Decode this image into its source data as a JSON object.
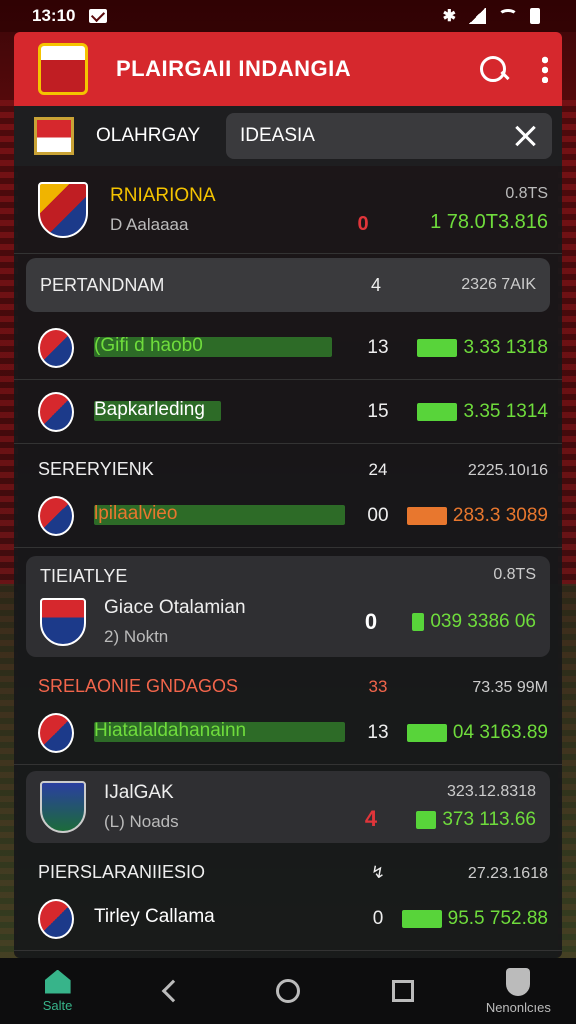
{
  "status": {
    "time": "13:10"
  },
  "appbar": {
    "title": "PLAIRGAII INDANGIA"
  },
  "filter": {
    "label": "OLAHRGAY",
    "search_value": "IDEASIA"
  },
  "featured": {
    "team_title": "RNIARIONA",
    "team_sub": "D Aalaaaa",
    "score": "0",
    "odds_top": "0.8TS",
    "odds_main": "1 78.0T3.816"
  },
  "section1": {
    "title": "PERTANDNAM",
    "mid": "4",
    "right": "2326 7AIK"
  },
  "rows1": [
    {
      "name": "(Gifi d haob0",
      "num": "13",
      "odds": "3.33 1318",
      "name_color": "#6fdc3c",
      "bar_color": "#2d6b27",
      "bar_pct": 0.9,
      "odds_color": "#6fdc3c",
      "oddbar_color": "#58d43a"
    },
    {
      "name": "Bapkarleding",
      "num": "15",
      "odds": "3.35 1314",
      "name_color": "#ffffff",
      "bar_color": "#2d6b27",
      "bar_pct": 0.48,
      "odds_color": "#6fdc3c",
      "oddbar_color": "#58d43a"
    }
  ],
  "section2": {
    "title": "SERERYIENK",
    "mid": "24",
    "right": "2225.10ı16"
  },
  "rows2": [
    {
      "name": "lpilaalvieo",
      "num": "00",
      "odds": "283.3 3089",
      "name_color": "#e8772e",
      "bar_color": "#2d6b27",
      "bar_pct": 0.95,
      "odds_color": "#e8772e",
      "oddbar_color": "#e8772e"
    }
  ],
  "card1": {
    "title": "TIEIATLYE",
    "right": "0.8TS",
    "team": "Giace Otalamian",
    "sub": "2) Noktn",
    "score": "0",
    "odds": "039 3386 06"
  },
  "section3": {
    "title": "SRELAONIE GNDAGOS",
    "mid": "33",
    "right": "73.35 99M"
  },
  "rows3": [
    {
      "name": "Hiatalaldahanainn",
      "num": "13",
      "odds": "04 3163.89",
      "name_color": "#6fdc3c",
      "bar_color": "#2d6b27",
      "bar_pct": 0.95,
      "odds_color": "#6fdc3c",
      "oddbar_color": "#58d43a"
    }
  ],
  "card2": {
    "team": "IJalGAK",
    "sub": "(L) Noads",
    "score": "4",
    "odds_top": "323.12.8318",
    "odds": "373 113.66"
  },
  "section4": {
    "title": "PIERSLARANIIESIO",
    "mid": "↯",
    "right": "27.23.1618"
  },
  "rows4": [
    {
      "name": "Tirley Callama",
      "num": "0",
      "odds": "95.5 752.88",
      "name_color": "#ffffff",
      "bar_color": "transparent",
      "bar_pct": 0,
      "odds_color": "#6fdc3c",
      "oddbar_color": "#58d43a"
    }
  ],
  "nav": {
    "home": "Salte",
    "right": "Nenonlcıes"
  },
  "colors": {
    "accent_red": "#d6282d",
    "green": "#6fdc3c",
    "orange": "#e8772e"
  }
}
